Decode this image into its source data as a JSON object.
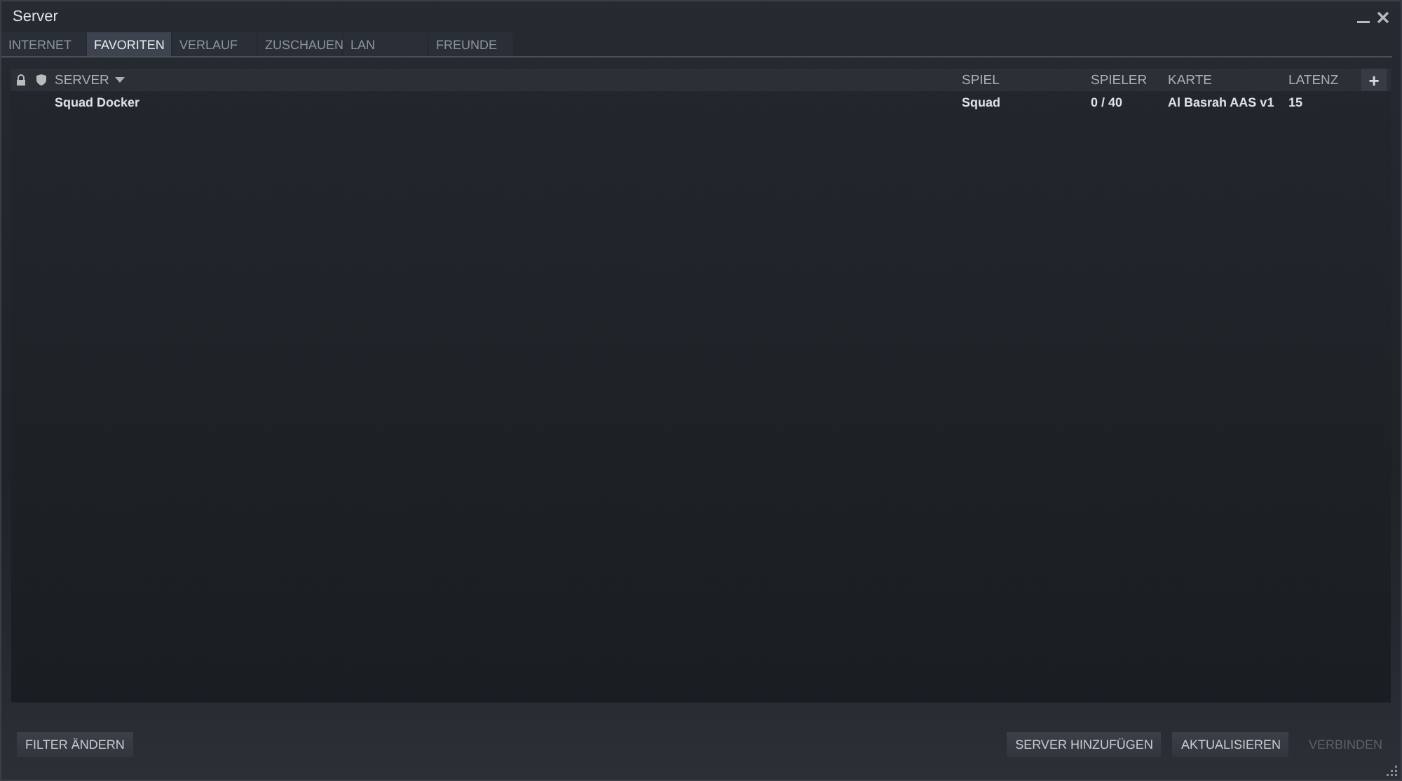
{
  "window": {
    "title": "Server"
  },
  "tabs": [
    {
      "label": "INTERNET",
      "selected": false
    },
    {
      "label": "FAVORITEN",
      "selected": true
    },
    {
      "label": "VERLAUF",
      "selected": false
    },
    {
      "label": "ZUSCHAUEN",
      "selected": false
    },
    {
      "label": "LAN",
      "selected": false
    },
    {
      "label": "FREUNDE",
      "selected": false
    }
  ],
  "table": {
    "columns": [
      {
        "kind": "lock"
      },
      {
        "kind": "shield"
      },
      {
        "kind": "text",
        "label": "SERVER",
        "sorted": true
      },
      {
        "kind": "text",
        "label": "SPIEL",
        "sorted": false
      },
      {
        "kind": "text",
        "label": "SPIELER",
        "sorted": false
      },
      {
        "kind": "text",
        "label": "KARTE",
        "sorted": false
      },
      {
        "kind": "text",
        "label": "LATENZ",
        "sorted": false
      }
    ],
    "add_column": "+",
    "rows": [
      {
        "cells": [
          "",
          "",
          "Squad Docker",
          "Squad",
          "0 / 40",
          "Al Basrah AAS v1",
          "15"
        ]
      }
    ]
  },
  "buttons_left": [
    {
      "label": "FILTER ÄNDERN",
      "disabled": false
    }
  ],
  "buttons_right": [
    {
      "label": "SERVER HINZUFÜGEN",
      "disabled": false
    },
    {
      "label": "AKTUALISIEREN",
      "disabled": false
    },
    {
      "label": "VERBINDEN",
      "disabled": true
    }
  ]
}
